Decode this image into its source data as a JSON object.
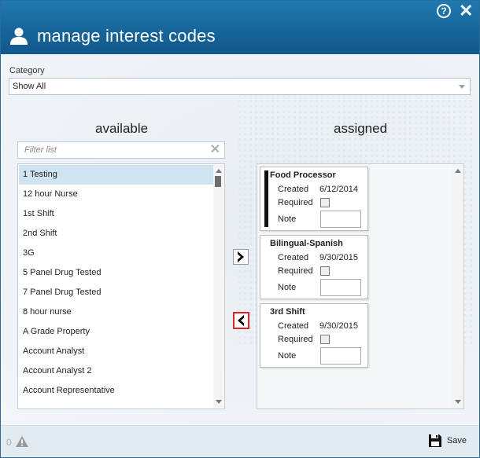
{
  "header": {
    "title": "manage interest codes",
    "help_icon": "help-icon",
    "close_icon": "close-icon"
  },
  "category": {
    "label": "Category",
    "value": "Show All"
  },
  "available": {
    "heading": "available",
    "filter_placeholder": "Filter list",
    "items": [
      "1 Testing",
      "12 hour Nurse",
      "1st Shift",
      "2nd Shift",
      "3G",
      "5 Panel Drug Tested",
      "7 Panel Drug Tested",
      "8 hour nurse",
      "A Grade Property",
      "Account Analyst",
      "Account Analyst 2",
      "Account Representative"
    ],
    "selected_index": 0
  },
  "assigned": {
    "heading": "assigned",
    "cards": [
      {
        "name": "Food Processor",
        "created_label": "Created",
        "created": "6/12/2014",
        "required_label": "Required",
        "note_label": "Note"
      },
      {
        "name": "Bilingual-Spanish",
        "created_label": "Created",
        "created": "9/30/2015",
        "required_label": "Required",
        "note_label": "Note"
      },
      {
        "name": "3rd Shift",
        "created_label": "Created",
        "created": "9/30/2015",
        "required_label": "Required",
        "note_label": "Note"
      }
    ]
  },
  "buttons": {
    "move_right_icon": "chevron-right-icon",
    "move_left_icon": "chevron-left-icon"
  },
  "footer": {
    "count": "0",
    "warning_icon": "warning-icon",
    "save_label": "Save"
  }
}
